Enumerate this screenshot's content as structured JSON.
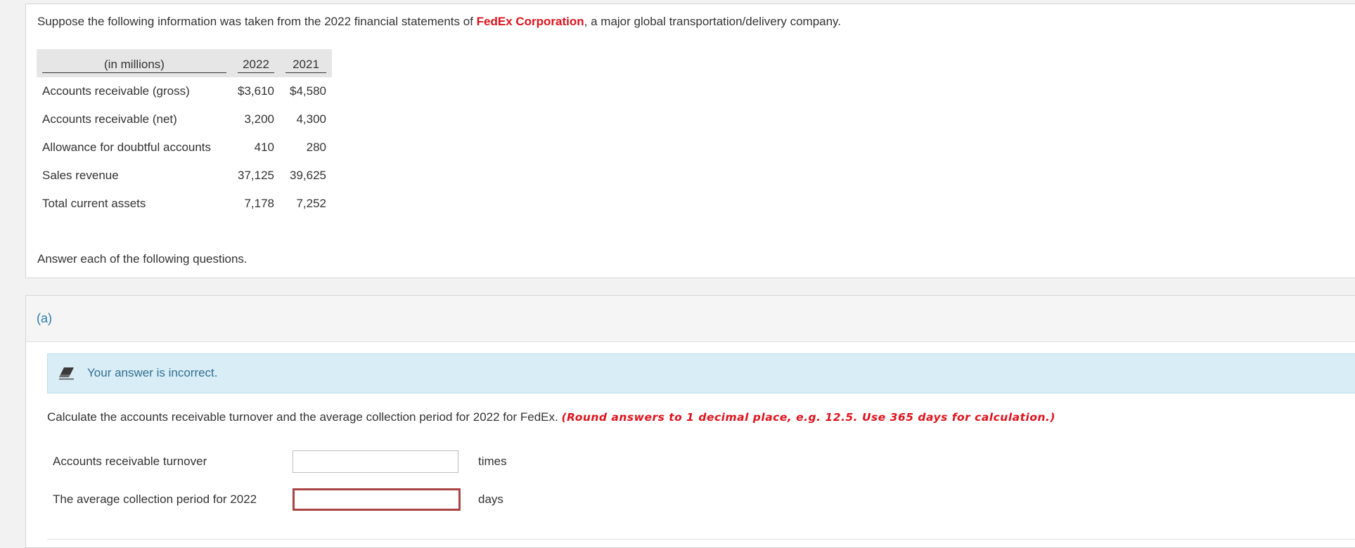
{
  "intro": {
    "before": "Suppose the following information was taken from the 2022 financial statements of ",
    "company": "FedEx Corporation",
    "after": ", a major global transportation/delivery company."
  },
  "table": {
    "headers": [
      "(in millions)",
      "2022",
      "2021"
    ],
    "rows": [
      {
        "label": "Accounts receivable (gross)",
        "y2022": "$3,610",
        "y2021": "$4,580"
      },
      {
        "label": "Accounts receivable (net)",
        "y2022": "3,200",
        "y2021": "4,300"
      },
      {
        "label": "Allowance for doubtful accounts",
        "y2022": "410",
        "y2021": "280"
      },
      {
        "label": "Sales revenue",
        "y2022": "37,125",
        "y2021": "39,625"
      },
      {
        "label": "Total current assets",
        "y2022": "7,178",
        "y2021": "7,252"
      }
    ]
  },
  "answer_note": "Answer each of the following questions.",
  "part": {
    "label": "(a)",
    "alert_icon": "eraser-icon",
    "alert_message": "Your answer is incorrect.",
    "question": "Calculate the accounts receivable turnover and the average collection period for 2022 for FedEx.",
    "instruction": "(Round answers to 1 decimal place, e.g. 12.5. Use 365 days for calculation.)",
    "fields": [
      {
        "label": "Accounts receivable turnover",
        "value": "",
        "unit": "times",
        "error": false
      },
      {
        "label": "The average collection period for 2022",
        "value": "",
        "unit": "days",
        "error": true
      }
    ]
  },
  "colors": {
    "accent_red": "#e0121b",
    "alert_bg": "#d9edf7",
    "alert_text": "#31708f",
    "error_border": "#a94442",
    "part_label": "#2a7ab0"
  }
}
